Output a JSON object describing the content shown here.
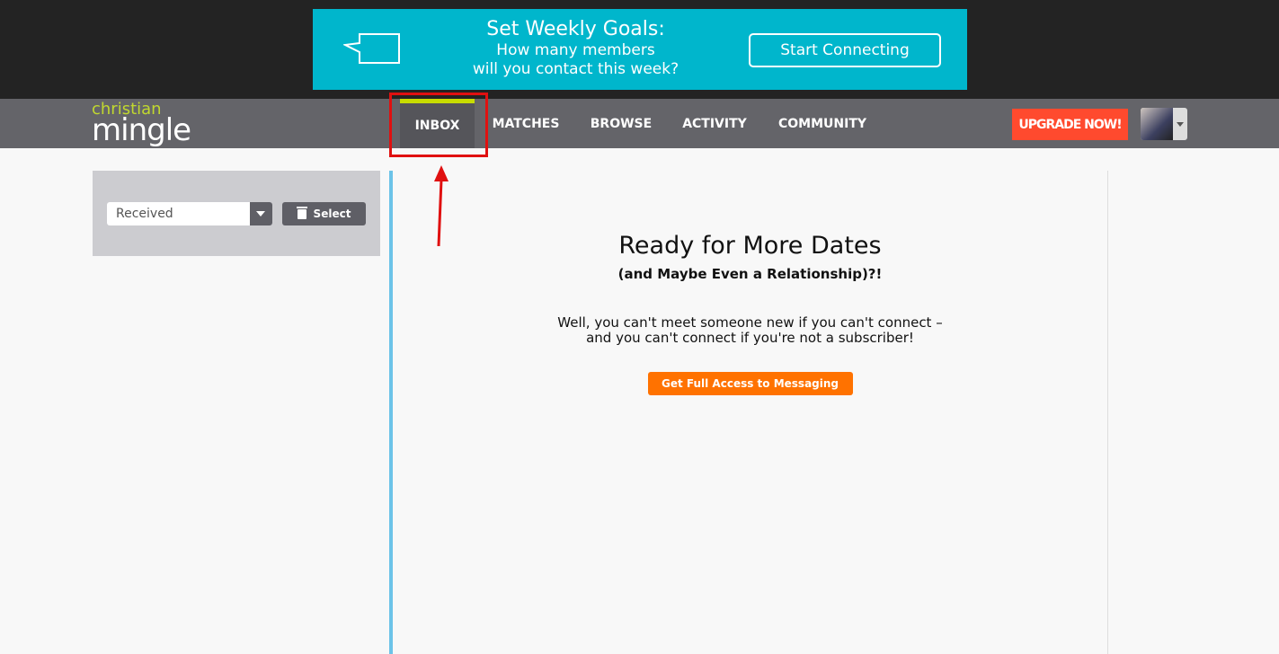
{
  "banner": {
    "title": "Set Weekly Goals:",
    "line1": "How many members",
    "line2": "will you contact this week?",
    "button": "Start Connecting"
  },
  "logo": {
    "top": "christian",
    "bottom": "mingle"
  },
  "nav": {
    "items": [
      "INBOX",
      "MATCHES",
      "BROWSE",
      "ACTIVITY",
      "COMMUNITY"
    ],
    "active": "INBOX",
    "upgrade": "UPGRADE NOW!"
  },
  "sidebar": {
    "folder": "Received",
    "select_label": "Select"
  },
  "main": {
    "title": "Ready for More Dates",
    "subtitle": "(and Maybe Even a Relationship)?!",
    "line1": "Well, you can't meet someone new if you can't connect –",
    "line2": "and you can't connect if you're not a subscriber!",
    "cta": "Get Full Access to Messaging"
  },
  "colors": {
    "banner": "#00b6cc",
    "accent": "#c8dc00",
    "upgrade": "#ff4a2e",
    "cta": "#ff7200",
    "annotation": "#e01010"
  }
}
